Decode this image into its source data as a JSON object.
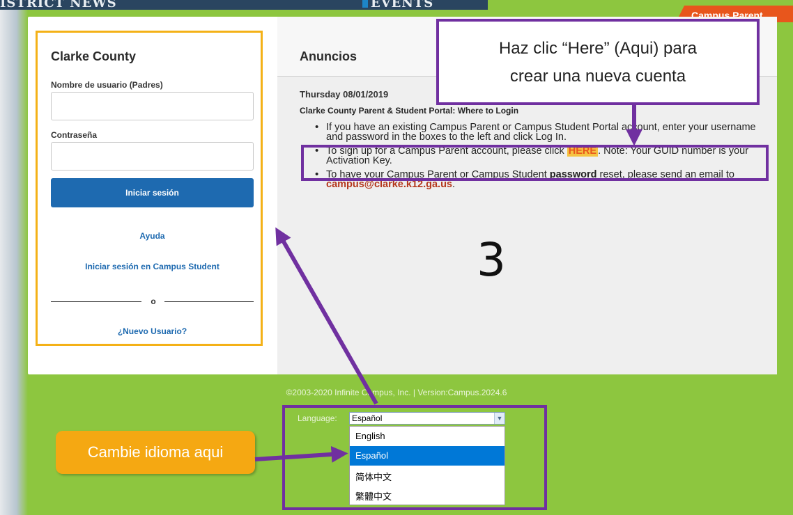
{
  "banner": {
    "left_text": "ISTRICT NEWS",
    "right_text": "EVENTS",
    "tab": "Campus Parent"
  },
  "login": {
    "title": "Clarke County",
    "username_label": "Nombre de usuario (Padres)",
    "username_value": "",
    "password_label": "Contraseña",
    "password_value": "",
    "login_button": "Iniciar sesión",
    "help_link": "Ayuda",
    "student_link": "Iniciar sesión en Campus Student",
    "divider": "o",
    "new_user_link": "¿Nuevo Usuario?"
  },
  "announcements": {
    "title": "Anuncios",
    "date": "Thursday 08/01/2019",
    "heading": "Clarke County Parent & Student Portal: Where to Login",
    "bullet1": "If you have an existing Campus Parent or Campus Student Portal account, enter your username and password in the boxes to the left and click Log In.",
    "bullet2_pre": "To sign up for a Campus Parent account, please click ",
    "bullet2_here": "HERE",
    "bullet2_post": ". Note: Your GUID number is your Activation Key.",
    "bullet3_pre": "To have your Campus Parent or Campus Student ",
    "bullet3_bold": "password",
    "bullet3_mid": " reset, please send an email to ",
    "bullet3_email": "campus@clarke.k12.ga.us",
    "bullet3_post": "."
  },
  "annotation": {
    "callout_line1": "Haz clic “Here” (Aqui) para",
    "callout_line2": "crear una nueva cuenta",
    "step_number": "3",
    "language_callout": "Cambie idioma aqui",
    "arrow_color": "#7030a0",
    "login_highlight_color": "#f4b117"
  },
  "footer": {
    "copyright": "©2003-2020 Infinite Campus, Inc. | Version:Campus.2024.6",
    "language_label": "Language:",
    "language_selected": "Español",
    "language_options": [
      "English",
      "Español",
      "简体中文",
      "繁體中文"
    ],
    "language_highlighted_index": 1
  },
  "colors": {
    "page_bg": "#8dc63f",
    "primary_button": "#1e6ab0",
    "accent": "#e8561c"
  }
}
